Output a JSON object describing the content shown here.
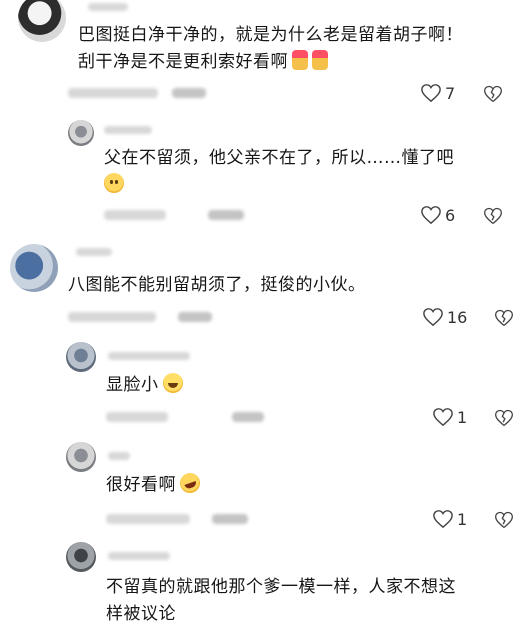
{
  "comments": [
    {
      "text_lines": [
        "巴图挺白净干净的，就是为什么老是留着胡子啊！",
        "刮干净是不是更利索好看啊"
      ],
      "like_count": "7"
    },
    {
      "text_lines": [
        "父在不留须，他父亲不在了，所以……懂了吧"
      ],
      "like_count": "6"
    },
    {
      "text_lines": [
        "八图能不能别留胡须了，挺俊的小伙。"
      ],
      "like_count": "16"
    },
    {
      "text_lines": [
        "显脸小"
      ],
      "like_count": "1"
    },
    {
      "text_lines": [
        "很好看啊"
      ],
      "like_count": "1"
    },
    {
      "text_lines": [
        "不留真的就跟他那个爹一模一样，人家不想这",
        "样被议论"
      ]
    }
  ],
  "icons": {
    "like": "heart-outline-icon",
    "dislike": "broken-heart-icon"
  },
  "colors": {
    "text": "#161616",
    "meta_blur": "#d8d8d8"
  }
}
